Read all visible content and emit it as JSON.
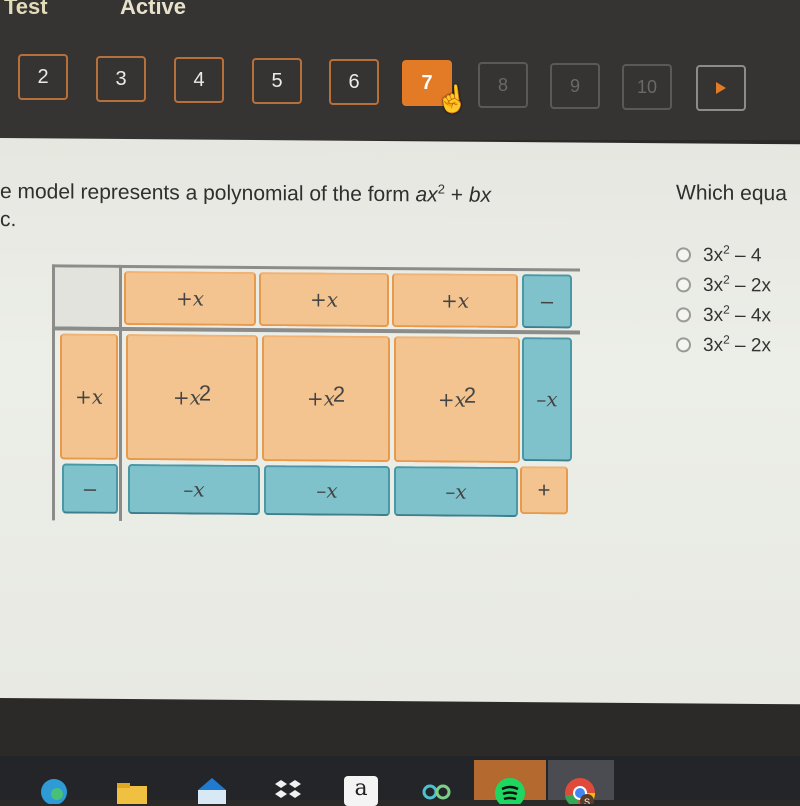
{
  "header": {
    "title_partial": "Test",
    "status": "Active"
  },
  "question_nav": {
    "items": [
      {
        "label": "2",
        "state": "answered"
      },
      {
        "label": "3",
        "state": "answered"
      },
      {
        "label": "4",
        "state": "answered"
      },
      {
        "label": "5",
        "state": "answered"
      },
      {
        "label": "6",
        "state": "answered"
      },
      {
        "label": "7",
        "state": "current"
      },
      {
        "label": "8",
        "state": "unvisited"
      },
      {
        "label": "9",
        "state": "unvisited"
      },
      {
        "label": "10",
        "state": "unvisited"
      }
    ],
    "next_icon": "play-triangle-icon",
    "cursor_icon": "hand-pointer-icon"
  },
  "prompt": {
    "line1_prefix": "e model represents a polynomial of the form ",
    "term_a": "ax",
    "exp": "2",
    "plus": " + ",
    "term_b": "bx",
    "line2": "c."
  },
  "question": {
    "text": "Which equa",
    "options": [
      {
        "prefix": "3x",
        "exp": "2",
        "rest": " – 4"
      },
      {
        "prefix": "3x",
        "exp": "2",
        "rest": " – 2x"
      },
      {
        "prefix": "3x",
        "exp": "2",
        "rest": " – 4x"
      },
      {
        "prefix": "3x",
        "exp": "2",
        "rest": " – 2x"
      }
    ]
  },
  "model": {
    "top_row": [
      "+x",
      "+x",
      "+x",
      "–"
    ],
    "left_col": [
      "+x",
      "–"
    ],
    "middle_row": [
      {
        "base": "+x",
        "exp": "2"
      },
      {
        "base": "+x",
        "exp": "2"
      },
      {
        "base": "+x",
        "exp": "2"
      },
      {
        "base": "–x",
        "exp": ""
      }
    ],
    "bottom_row": [
      "–x",
      "–x",
      "–x",
      "+"
    ],
    "colors": {
      "positive": "#f3c48f",
      "negative": "#7fc2cc"
    }
  },
  "taskbar": {
    "icons": [
      "edge-icon",
      "file-explorer-icon",
      "mail-icon",
      "dropbox-icon",
      "amazon-icon",
      "infinity-app-icon",
      "spotify-icon",
      "chrome-icon"
    ],
    "amazon_label": "a",
    "chrome_badge": "S"
  },
  "colors": {
    "accent": "#e27a26",
    "header_bg": "#363432",
    "content_bg": "#e8e9e3"
  }
}
